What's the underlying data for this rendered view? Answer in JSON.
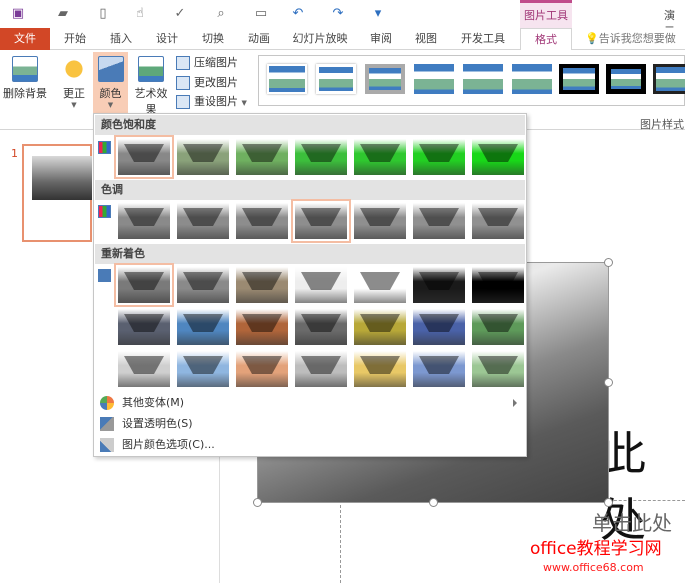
{
  "quick_access": [
    "save-icon",
    "open-icon",
    "new-icon",
    "touch-mode-icon",
    "spelling-icon",
    "print-preview-icon",
    "present-icon",
    "undo-icon",
    "redo-icon",
    "customize-icon"
  ],
  "context_tab": "图片工具",
  "window_title": "演示",
  "tabs": {
    "file": "文件",
    "items": [
      "开始",
      "插入",
      "设计",
      "切换",
      "动画",
      "幻灯片放映",
      "审阅",
      "视图",
      "开发工具"
    ],
    "active": "格式"
  },
  "tellme": "告诉我您想要做什么",
  "ribbon": {
    "remove_bg": "删除背景",
    "corrections": "更正",
    "color": "颜色",
    "artistic": "艺术效果",
    "compress": "压缩图片",
    "change": "更改图片",
    "reset": "重设图片",
    "styles_group": "图片样式"
  },
  "slide_number": "1",
  "slide": {
    "title_fragment": "此处",
    "subtitle_fragment": "单击此处"
  },
  "watermark": {
    "line1": "office教程学习网",
    "line2": "www.office68.com"
  },
  "dropdown": {
    "sections": [
      "颜色饱和度",
      "色调",
      "重新着色"
    ],
    "saturation": [
      {
        "s": 0,
        "c": "#888888"
      },
      {
        "s": 0.33,
        "c": "#8aa27a"
      },
      {
        "s": 0.66,
        "c": "#6fb060"
      },
      {
        "s": 1,
        "c": "#3cbf3c"
      },
      {
        "s": 1.33,
        "c": "#2fc82f"
      },
      {
        "s": 1.66,
        "c": "#22d022"
      },
      {
        "s": 2,
        "c": "#18d818"
      }
    ],
    "saturation_selected": 0,
    "tone": [
      "#8a8a8a",
      "#8c8c8c",
      "#8d8d8d",
      "#8e8e8e",
      "#8f8f8f",
      "#909090",
      "#919191"
    ],
    "tone_selected": 3,
    "recolor": [
      [
        "#7a7a7a",
        "#8a8a8a",
        "#9b8a72",
        "#eeeeee",
        "#ffffff",
        "#1a1a1a",
        "#000000"
      ],
      [
        "#5a6070",
        "#4f86c0",
        "#b0653a",
        "#6a6a6a",
        "#b8a838",
        "#4a62a8",
        "#5e9a5a"
      ],
      [
        "#cfcfcf",
        "#8fb6e0",
        "#e3a27a",
        "#bdbdbd",
        "#e8c866",
        "#7c98d0",
        "#9cc794"
      ]
    ],
    "recolor_selected": 0,
    "menu": [
      {
        "label": "其他变体(M)",
        "icon": "color-wheel-icon",
        "submenu": true
      },
      {
        "label": "设置透明色(S)",
        "icon": "set-transparent-icon"
      },
      {
        "label": "图片颜色选项(C)...",
        "icon": "picture-color-options-icon"
      }
    ]
  }
}
